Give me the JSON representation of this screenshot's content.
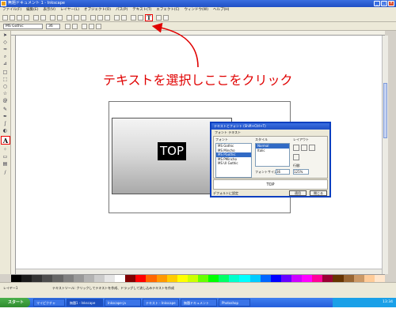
{
  "window": {
    "title": "無題ドキュメント 1 - Inkscape",
    "buttons": [
      "_",
      "□",
      "×"
    ]
  },
  "menubar": {
    "items": [
      "ファイル(F)",
      "編集(E)",
      "表示(V)",
      "レイヤー(L)",
      "オブジェクト(O)",
      "パス(P)",
      "テキスト(T)",
      "エフェクト(C)",
      "ウィンドウ(W)",
      "ヘルプ(H)"
    ]
  },
  "toolbar": {
    "text_tool_glyph": "T"
  },
  "controls": {
    "font_family": "MS Gothic",
    "font_size": "36"
  },
  "toolbox": {
    "text_tool_glyph": "A"
  },
  "annotation": {
    "instruction": "テキストを選択しここをクリック",
    "color": "#e00000"
  },
  "canvas": {
    "label": "TOP"
  },
  "dialog": {
    "title": "テキストとフォント (Shift+Ctrl+T)",
    "tab": "フォント テキスト",
    "group_font": "フォント",
    "group_style": "スタイル",
    "group_layout": "レイアウト",
    "font_list": [
      "MS Gothic",
      "MS Mincho",
      "MS PGothic",
      "MS PMincho",
      "MS UI Gothic"
    ],
    "selected_font_index": 2,
    "style_list": [
      "Normal",
      "Italic"
    ],
    "spacing_label": "行間:",
    "spacing_value": "125%",
    "font_size_label": "フォントサイズ",
    "font_size_value": "36",
    "preview_text": "TOP",
    "default_button": "デフォルトに設定",
    "apply_button": "適用",
    "close_button": "閉じる"
  },
  "statusbar": {
    "message": "テキストツール: クリックしてテキストを作成、ドラッグして流し込みテキストを作成",
    "layer": "レイヤー1"
  },
  "palette_colors": [
    "#000000",
    "#1a1a1a",
    "#333333",
    "#4d4d4d",
    "#666666",
    "#808080",
    "#999999",
    "#b3b3b3",
    "#cccccc",
    "#e6e6e6",
    "#ffffff",
    "#800000",
    "#ff0000",
    "#ff6600",
    "#ff9900",
    "#ffcc00",
    "#ffff00",
    "#ccff00",
    "#66ff00",
    "#00ff00",
    "#00ff66",
    "#00ffcc",
    "#00ffff",
    "#00ccff",
    "#0066ff",
    "#0000ff",
    "#6600ff",
    "#cc00ff",
    "#ff00ff",
    "#ff0099",
    "#990033",
    "#663300",
    "#996633",
    "#cc9966",
    "#ffcc99",
    "#ffe6cc"
  ],
  "taskbar": {
    "start": "スタート",
    "tasks": [
      "マイピクチャ",
      "無題1 - Inkscape",
      "Inkscape-ja",
      "テキスト - Inkscape",
      "無題ドキュメント",
      "Photoshop"
    ],
    "tray_time": "13:34"
  }
}
